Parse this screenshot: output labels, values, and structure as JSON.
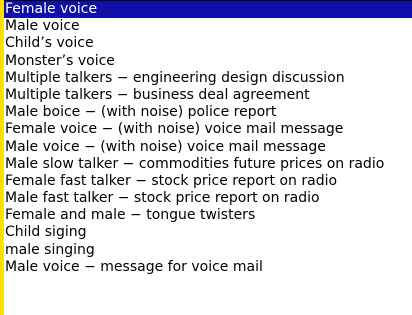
{
  "listbox": {
    "selected_index": 0,
    "colors": {
      "selection_background": "#1010a8",
      "selection_text": "#ffffff",
      "left_edge": "#fbe000"
    },
    "items": [
      "Female voice",
      "Male voice",
      "Child’s voice",
      "Monster’s voice",
      "Multiple talkers − engineering design discussion",
      "Multiple talkers − business deal agreement",
      "Male boice − (with noise) police report",
      "Female voice − (with noise) voice mail message",
      "Male voice − (with noise) voice mail message",
      "Male slow talker − commodities future prices on radio",
      "Female fast talker − stock price report on radio",
      "Male fast talker − stock price report on radio",
      "Female and male − tongue twisters",
      "Child siging",
      "male singing",
      "Male voice − message for voice mail"
    ]
  }
}
